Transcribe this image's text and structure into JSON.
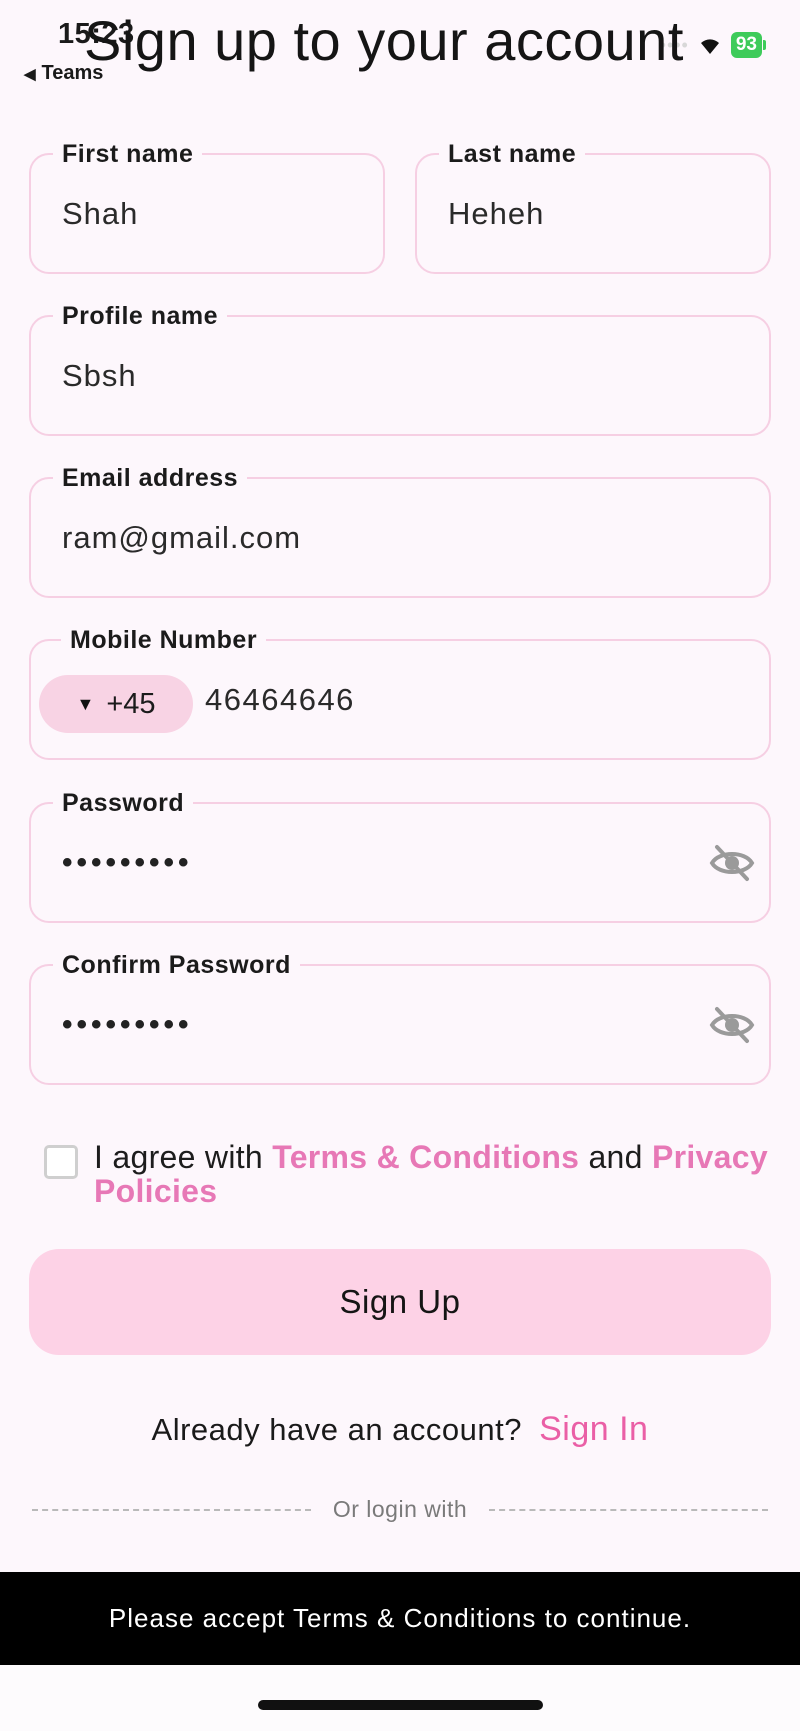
{
  "status_bar": {
    "time": "15:23",
    "back_app": "Teams",
    "signal": "••••",
    "battery": "93"
  },
  "page": {
    "title": "Sign up to your account"
  },
  "fields": {
    "first_name": {
      "label": "First name",
      "value": "Shah"
    },
    "last_name": {
      "label": "Last name",
      "value": "Heheh"
    },
    "profile_name": {
      "label": "Profile name",
      "value": "Sbsh"
    },
    "email": {
      "label": "Email address",
      "value": "ram@gmail.com"
    },
    "mobile": {
      "label": "Mobile Number",
      "country_code": "+45",
      "value": "46464646"
    },
    "password": {
      "label": "Password",
      "masked_value": "•••••••••",
      "toggle_icon": "eye-off-icon"
    },
    "confirm_password": {
      "label": "Confirm Password",
      "masked_value": "•••••••••",
      "toggle_icon": "eye-off-icon"
    }
  },
  "terms": {
    "checked": false,
    "prefix": "I agree with ",
    "terms_link": "Terms & Conditions",
    "middle": " and ",
    "privacy_link": "Privacy Policies"
  },
  "actions": {
    "signup_label": "Sign Up",
    "signin_prompt": "Already have an account?",
    "signin_link": "Sign In",
    "divider_text": "Or login with"
  },
  "snackbar": {
    "message": "Please accept Terms & Conditions to continue."
  },
  "colors": {
    "background": "#fdf7fc",
    "field_border": "#f6cfe3",
    "accent_pink": "#ea5fa6",
    "button_pink": "#fdd2e6",
    "battery_green": "#3ecb5a",
    "snackbar": "#000000"
  }
}
